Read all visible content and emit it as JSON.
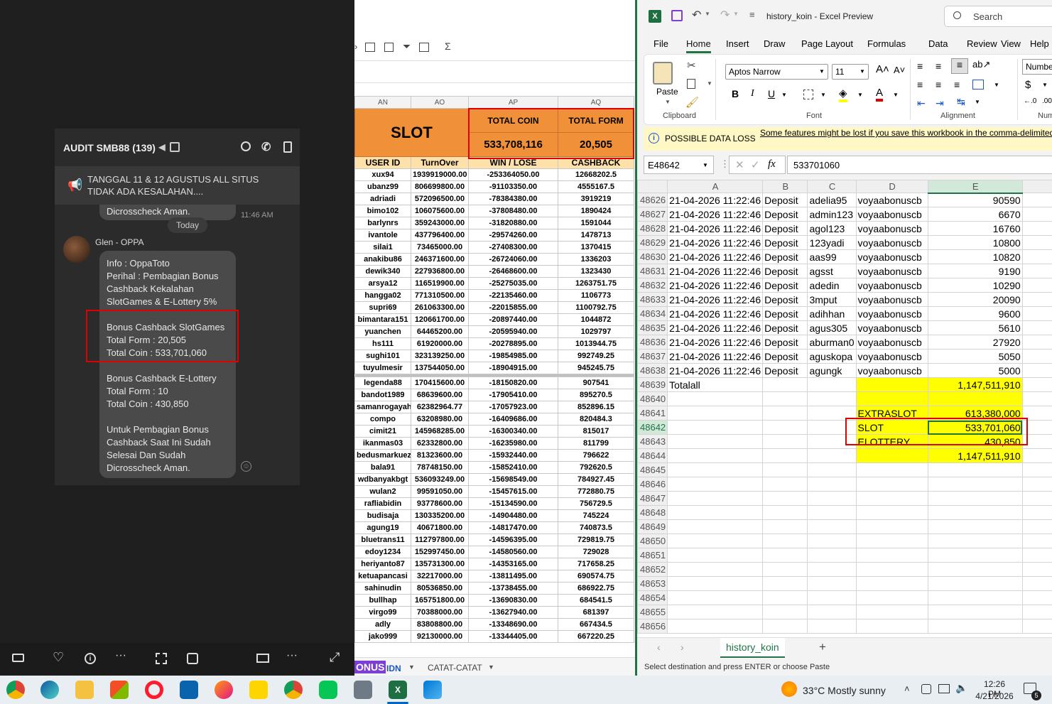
{
  "chat": {
    "title": "AUDIT SMB88 (139)",
    "pinned": "TANGGAL 11 & 12 AGUSTUS ALL SITUS TIDAK ADA KESALAHAN....",
    "prev_message_tail": "Dicrosscheck Aman.",
    "prev_time": "11:46 AM",
    "day_divider": "Today",
    "sender": "Glen - OPPA",
    "message": {
      "line1": "Info : OppaToto",
      "line2": "Perihal : Pembagian Bonus",
      "line3": "Cashback Kekalahan",
      "line4": "SlotGames & E-Lottery 5%",
      "slot_title": "Bonus Cashback SlotGames",
      "slot_form": "Total Form : 20,505",
      "slot_coin": "Total Coin : 533,701,060",
      "lot_title": "Bonus Cashback E-Lottery",
      "lot_form": "Total Form : 10",
      "lot_coin": "Total Coin : 430,850",
      "end1": "Untuk Pembagian Bonus",
      "end2": "Cashback Saat Ini Sudah",
      "end3": "Selesai Dan Sudah",
      "end4": "Dicrosscheck Aman."
    }
  },
  "sheet": {
    "cols": [
      "AN",
      "AO",
      "AP",
      "AQ"
    ],
    "slot_label": "SLOT",
    "total_coin_label": "TOTAL COIN",
    "total_form_label": "TOTAL FORM",
    "total_coin": "533,708,116",
    "total_form": "20,505",
    "headers": [
      "USER ID",
      "TurnOver",
      "WIN / LOSE",
      "CASHBACK"
    ],
    "rows_top": [
      [
        "xux94",
        "1939919000.00",
        "-253364050.00",
        "12668202.5"
      ],
      [
        "ubanz99",
        "806699800.00",
        "-91103350.00",
        "4555167.5"
      ],
      [
        "adriadi",
        "572096500.00",
        "-78384380.00",
        "3919219"
      ],
      [
        "bimo102",
        "106075600.00",
        "-37808480.00",
        "1890424"
      ],
      [
        "barlynrs",
        "359243000.00",
        "-31820880.00",
        "1591044"
      ],
      [
        "ivantole",
        "437796400.00",
        "-29574260.00",
        "1478713"
      ],
      [
        "silai1",
        "73465000.00",
        "-27408300.00",
        "1370415"
      ],
      [
        "anakibu86",
        "246371600.00",
        "-26724060.00",
        "1336203"
      ],
      [
        "dewik340",
        "227936800.00",
        "-26468600.00",
        "1323430"
      ],
      [
        "arsya12",
        "116519900.00",
        "-25275035.00",
        "1263751.75"
      ],
      [
        "hangga02",
        "771310500.00",
        "-22135460.00",
        "1106773"
      ],
      [
        "supri69",
        "261063300.00",
        "-22015855.00",
        "1100792.75"
      ],
      [
        "bimantara151",
        "120661700.00",
        "-20897440.00",
        "1044872"
      ],
      [
        "yuanchen",
        "64465200.00",
        "-20595940.00",
        "1029797"
      ],
      [
        "hs111",
        "61920000.00",
        "-20278895.00",
        "1013944.75"
      ],
      [
        "sughi101",
        "323139250.00",
        "-19854985.00",
        "992749.25"
      ],
      [
        "tuyulmesir",
        "137544050.00",
        "-18904915.00",
        "945245.75"
      ]
    ],
    "rows_bottom": [
      [
        "legenda88",
        "170415600.00",
        "-18150820.00",
        "907541"
      ],
      [
        "bandot1989",
        "68639600.00",
        "-17905410.00",
        "895270.5"
      ],
      [
        "samanrogayah",
        "62382964.77",
        "-17057923.00",
        "852896.15"
      ],
      [
        "compo",
        "63208980.00",
        "-16409686.00",
        "820484.3"
      ],
      [
        "cimit21",
        "145968285.00",
        "-16300340.00",
        "815017"
      ],
      [
        "ikanmas03",
        "62332800.00",
        "-16235980.00",
        "811799"
      ],
      [
        "bedusmarkuez",
        "81323600.00",
        "-15932440.00",
        "796622"
      ],
      [
        "bala91",
        "78748150.00",
        "-15852410.00",
        "792620.5"
      ],
      [
        "wdbanyakbgt",
        "536093249.00",
        "-15698549.00",
        "784927.45"
      ],
      [
        "wulan2",
        "99591050.00",
        "-15457615.00",
        "772880.75"
      ],
      [
        "rafliabidin",
        "93778600.00",
        "-15134590.00",
        "756729.5"
      ],
      [
        "budisaja",
        "130335200.00",
        "-14904480.00",
        "745224"
      ],
      [
        "agung19",
        "40671800.00",
        "-14817470.00",
        "740873.5"
      ],
      [
        "bluetrans11",
        "112797800.00",
        "-14596395.00",
        "729819.75"
      ],
      [
        "edoy1234",
        "152997450.00",
        "-14580560.00",
        "729028"
      ],
      [
        "heriyanto87",
        "135731300.00",
        "-14353165.00",
        "717658.25"
      ],
      [
        "ketuapancasi",
        "32217000.00",
        "-13811495.00",
        "690574.75"
      ],
      [
        "sahinudin",
        "80536850.00",
        "-13738455.00",
        "686922.75"
      ],
      [
        "bullhap",
        "165751800.00",
        "-13690830.00",
        "684541.5"
      ],
      [
        "virgo99",
        "70388000.00",
        "-13627940.00",
        "681397"
      ],
      [
        "adly",
        "83808800.00",
        "-13348690.00",
        "667434.5"
      ],
      [
        "jako999",
        "92130000.00",
        "-13344405.00",
        "667220.25"
      ]
    ],
    "tab_bonus": "ONUS",
    "tab_idn": "IDN",
    "tab_catat": "CATAT-CATAT"
  },
  "excel": {
    "title": "history_koin  -  Excel Preview",
    "search": "Search",
    "menu": [
      "File",
      "Home",
      "Insert",
      "Draw",
      "Page Layout",
      "Formulas",
      "Data",
      "Review",
      "View",
      "Help"
    ],
    "font_name": "Aptos Narrow",
    "font_size": "11",
    "number_format": "Numbe",
    "groups": [
      "Clipboard",
      "Font",
      "Alignment",
      "Num"
    ],
    "paste": "Paste",
    "warning_title": "POSSIBLE DATA LOSS",
    "warning_text": "Some features might be lost if you save this workbook in the comma-delimited (.csv) format.",
    "name_box": "E48642",
    "formula": "533701060",
    "col_headers": [
      "A",
      "B",
      "C",
      "D",
      "E"
    ],
    "rows": [
      [
        "48626",
        "21-04-2026 11:22:46",
        "Deposit",
        "adelia95",
        "voyaabonuscb",
        "90590"
      ],
      [
        "48627",
        "21-04-2026 11:22:46",
        "Deposit",
        "admin123",
        "voyaabonuscb",
        "6670"
      ],
      [
        "48628",
        "21-04-2026 11:22:46",
        "Deposit",
        "agol123",
        "voyaabonuscb",
        "16760"
      ],
      [
        "48629",
        "21-04-2026 11:22:46",
        "Deposit",
        "123yadi",
        "voyaabonuscb",
        "10800"
      ],
      [
        "48630",
        "21-04-2026 11:22:46",
        "Deposit",
        "aas99",
        "voyaabonuscb",
        "10820"
      ],
      [
        "48631",
        "21-04-2026 11:22:46",
        "Deposit",
        "agsst",
        "voyaabonuscb",
        "9190"
      ],
      [
        "48632",
        "21-04-2026 11:22:46",
        "Deposit",
        "adedin",
        "voyaabonuscb",
        "10290"
      ],
      [
        "48633",
        "21-04-2026 11:22:46",
        "Deposit",
        "3mput",
        "voyaabonuscb",
        "20090"
      ],
      [
        "48634",
        "21-04-2026 11:22:46",
        "Deposit",
        "adihhan",
        "voyaabonuscb",
        "9600"
      ],
      [
        "48635",
        "21-04-2026 11:22:46",
        "Deposit",
        "agus305",
        "voyaabonuscb",
        "5610"
      ],
      [
        "48636",
        "21-04-2026 11:22:46",
        "Deposit",
        "aburman0",
        "voyaabonuscb",
        "27920"
      ],
      [
        "48637",
        "21-04-2026 11:22:46",
        "Deposit",
        "aguskopa",
        "voyaabonuscb",
        "5050"
      ],
      [
        "48638",
        "21-04-2026 11:22:46",
        "Deposit",
        "agungk",
        "voyaabonuscb",
        "5000"
      ]
    ],
    "total_label": "Totalall",
    "total_value": "1,147,511,910",
    "extraslot_label": "EXTRASLOT",
    "extraslot_value": "613,380,000",
    "slot_label": "SLOT",
    "slot_value": "533,701,060",
    "elottery_label": "ELOTTERY",
    "elottery_value": "430,850",
    "sum_value": "1,147,511,910",
    "empty_rows": [
      "48640",
      "48645",
      "48646",
      "48647",
      "48648",
      "48649",
      "48650",
      "48651",
      "48652",
      "48653",
      "48654",
      "48655",
      "48656"
    ],
    "sheet_tab": "history_koin",
    "status": "Select destination and press ENTER or choose Paste"
  },
  "taskbar": {
    "weather": "33°C  Mostly sunny",
    "time": "12:26 PM",
    "date": "4/21/2026",
    "notif": "5"
  }
}
